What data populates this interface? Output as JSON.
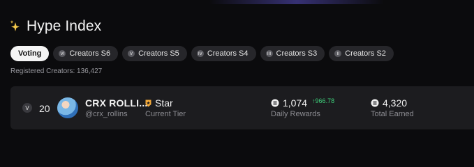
{
  "header": {
    "title": "Hype Index",
    "icon": "sparkle-icon",
    "accent_color": "#f3c84b"
  },
  "tabs": [
    {
      "label": "Voting",
      "active": true,
      "icon": ""
    },
    {
      "label": "Creators S6",
      "active": false,
      "icon": "season-icon"
    },
    {
      "label": "Creators S5",
      "active": false,
      "icon": "season-icon"
    },
    {
      "label": "Creators S4",
      "active": false,
      "icon": "season-icon"
    },
    {
      "label": "Creators S3",
      "active": false,
      "icon": "season-icon"
    },
    {
      "label": "Creators S2",
      "active": false,
      "icon": "season-icon"
    }
  ],
  "registered": {
    "label": "Registered Creators: 136,427"
  },
  "creator_row": {
    "rank": "20",
    "name": "CRX ROLLI...",
    "handle": "@crx_rollins",
    "tier": {
      "value": "Star",
      "label": "Current Tier",
      "icon": "tier-badge-icon",
      "color": "#f2a93b"
    },
    "daily_rewards": {
      "value": "1,074",
      "change": "↑966.78",
      "label": "Daily Rewards",
      "change_color": "#3ed07b"
    },
    "total_earned": {
      "value": "4,320",
      "label": "Total Earned"
    }
  }
}
